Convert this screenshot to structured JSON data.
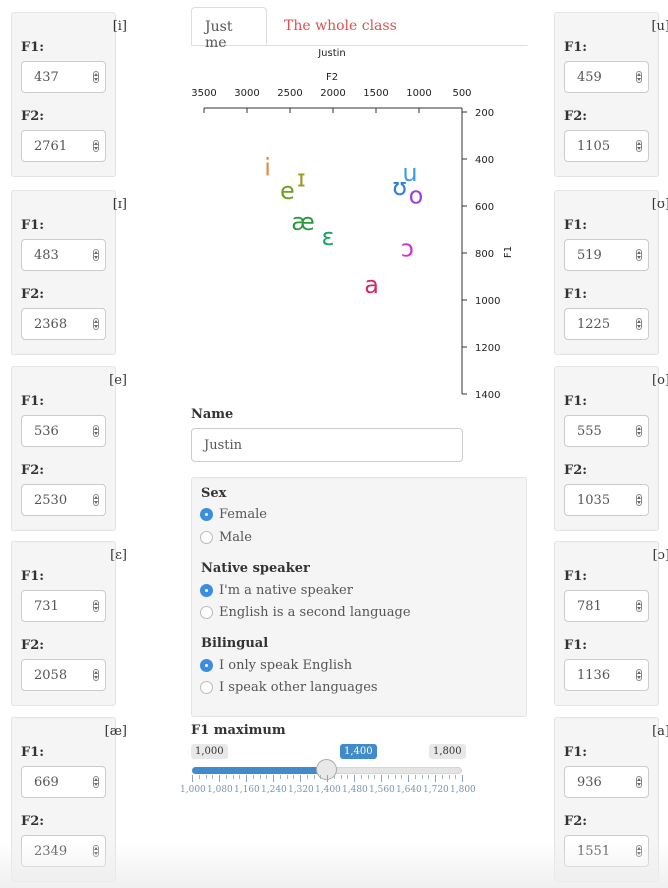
{
  "tabs": [
    "Just me",
    "The whole class"
  ],
  "plot": {
    "title": "Justin",
    "x_label": "F2",
    "y_label": "F1",
    "x_ticks": [
      "3500",
      "3000",
      "2500",
      "2000",
      "1500",
      "1000",
      "500"
    ],
    "y_ticks": [
      "200",
      "400",
      "600",
      "800",
      "1000",
      "1200",
      "1400"
    ],
    "vowels": [
      {
        "symbol": "i",
        "f1": 437,
        "f2": 2761,
        "color": "#e08a3c"
      },
      {
        "symbol": "ɪ",
        "f1": 483,
        "f2": 2368,
        "color": "#9a9a20"
      },
      {
        "symbol": "e",
        "f1": 536,
        "f2": 2530,
        "color": "#6fa020"
      },
      {
        "symbol": "ɛ",
        "f1": 731,
        "f2": 2058,
        "color": "#1aa060"
      },
      {
        "symbol": "æ",
        "f1": 669,
        "f2": 2349,
        "color": "#2a9a40"
      },
      {
        "symbol": "u",
        "f1": 459,
        "f2": 1105,
        "color": "#3a9fe0"
      },
      {
        "symbol": "ʊ",
        "f1": 519,
        "f2": 1225,
        "color": "#2f7fd8"
      },
      {
        "symbol": "o",
        "f1": 555,
        "f2": 1035,
        "color": "#9a45e0"
      },
      {
        "symbol": "ɔ",
        "f1": 781,
        "f2": 1136,
        "color": "#d82fd0"
      },
      {
        "symbol": "a",
        "f1": 936,
        "f2": 1551,
        "color": "#d02a6a"
      }
    ]
  },
  "left_panels": [
    {
      "symbol": "[i]",
      "label1": "F1:",
      "value1": "437",
      "label2": "F2:",
      "value2": "2761"
    },
    {
      "symbol": "[ɪ]",
      "label1": "F1:",
      "value1": "483",
      "label2": "F2:",
      "value2": "2368"
    },
    {
      "symbol": "[e]",
      "label1": "F1:",
      "value1": "536",
      "label2": "F2:",
      "value2": "2530"
    },
    {
      "symbol": "[ɛ]",
      "label1": "F1:",
      "value1": "731",
      "label2": "F2:",
      "value2": "2058"
    },
    {
      "symbol": "[æ]",
      "label1": "F1:",
      "value1": "669",
      "label2": "F2:",
      "value2": "2349"
    }
  ],
  "right_panels": [
    {
      "symbol": "[u]",
      "label1": "F1:",
      "value1": "459",
      "label2": "F2:",
      "value2": "1105"
    },
    {
      "symbol": "[ʊ]",
      "label1": "F1:",
      "value1": "519",
      "label2": "F1:",
      "value2": "1225"
    },
    {
      "symbol": "[o]",
      "label1": "F1:",
      "value1": "555",
      "label2": "F2:",
      "value2": "1035"
    },
    {
      "symbol": "[ɔ]",
      "label1": "F1:",
      "value1": "781",
      "label2": "F1:",
      "value2": "1136"
    },
    {
      "symbol": "[a]",
      "label1": "F1:",
      "value1": "936",
      "label2": "F2:",
      "value2": "1551"
    }
  ],
  "name": {
    "label": "Name",
    "value": "Justin"
  },
  "demographics": {
    "sex": {
      "title": "Sex",
      "options": [
        "Female",
        "Male"
      ],
      "selected": 0
    },
    "native": {
      "title": "Native speaker",
      "options": [
        "I'm a native speaker",
        "English is a second language"
      ],
      "selected": 0
    },
    "bilingual": {
      "title": "Bilingual",
      "options": [
        "I only speak English",
        "I speak other languages"
      ],
      "selected": 0
    }
  },
  "slider": {
    "label": "F1 maximum",
    "min_label": "1,000",
    "max_label": "1,800",
    "value_label": "1,400",
    "value": 1400,
    "min": 1000,
    "max": 1800,
    "grid_labels": [
      "1,000",
      "1,080",
      "1,160",
      "1,240",
      "1,320",
      "1,400",
      "1,480",
      "1,560",
      "1,640",
      "1,720",
      "1,800"
    ]
  }
}
